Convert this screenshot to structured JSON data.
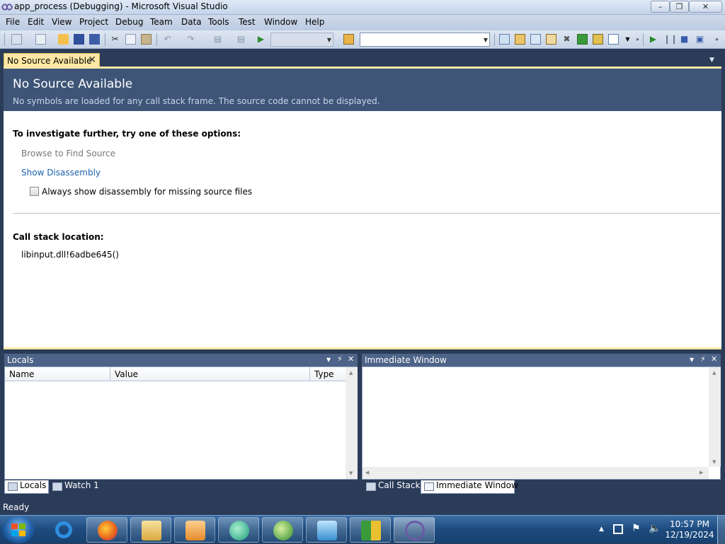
{
  "window": {
    "title": "app_process (Debugging) - Microsoft Visual Studio"
  },
  "menu": [
    "File",
    "Edit",
    "View",
    "Project",
    "Debug",
    "Team",
    "Data",
    "Tools",
    "Test",
    "Window",
    "Help"
  ],
  "toolbar": {
    "config_combo": "",
    "find_combo": ""
  },
  "tab": {
    "label": "No Source Available"
  },
  "document": {
    "title": "No Source Available",
    "subtitle": "No symbols are loaded for any call stack frame. The source code cannot be displayed.",
    "options_heading": "To investigate further, try one of these options:",
    "browse_link": "Browse to Find Source",
    "disassembly_link": "Show Disassembly",
    "always_checkbox_label": "Always show disassembly for missing source files",
    "always_checked": false,
    "callstack_heading": "Call stack location:",
    "callstack_location": "libinput.dll!6adbe645()"
  },
  "locals": {
    "title": "Locals",
    "columns": [
      "Name",
      "Value",
      "Type"
    ],
    "tabs": [
      "Locals",
      "Watch 1"
    ]
  },
  "immediate": {
    "title": "Immediate Window",
    "tabs": [
      "Call Stack",
      "Immediate Window"
    ]
  },
  "status": {
    "text": "Ready"
  },
  "taskbar": {
    "apps": [
      "internet-explorer",
      "firefox",
      "file-explorer",
      "media-player",
      "messenger",
      "windows-media-center",
      "visual-studio-debugger",
      "app-tile",
      "visual-studio"
    ],
    "clock_time": "10:57 PM",
    "clock_date": "12/19/2024"
  }
}
